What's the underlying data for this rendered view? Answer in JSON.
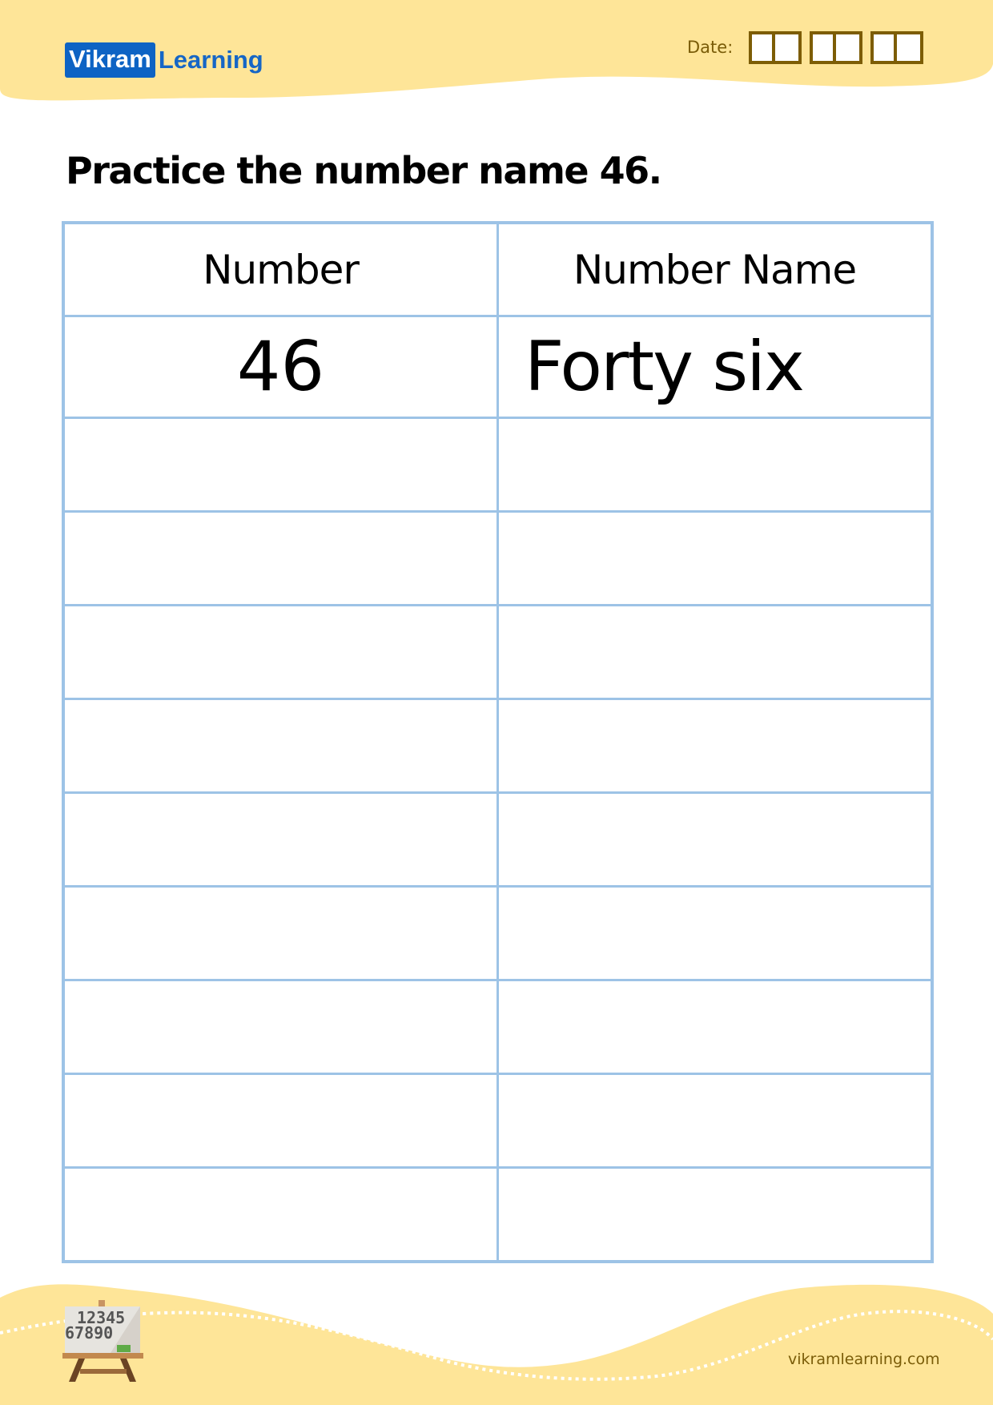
{
  "header": {
    "logo": {
      "part1": "Vikram",
      "part2": "Learning"
    },
    "date": {
      "label": "Date:",
      "groups": [
        2,
        2,
        2
      ]
    }
  },
  "title": "Practice the number name 46.",
  "table": {
    "headers": [
      "Number",
      "Number Name"
    ],
    "rows": [
      [
        "46",
        "Forty six"
      ],
      [
        "",
        ""
      ],
      [
        "",
        ""
      ],
      [
        "",
        ""
      ],
      [
        "",
        ""
      ],
      [
        "",
        ""
      ],
      [
        "",
        ""
      ],
      [
        "",
        ""
      ],
      [
        "",
        ""
      ],
      [
        "",
        ""
      ]
    ]
  },
  "footer": {
    "illustration": "easel-board-icon",
    "board_digits": [
      "12345",
      "67890"
    ],
    "website": "vikramlearning.com"
  },
  "colors": {
    "banner": "#fee598",
    "brand_blue": "#0d63c4",
    "table_border": "#9dc3e6",
    "date_box_border": "#7d5d05"
  }
}
